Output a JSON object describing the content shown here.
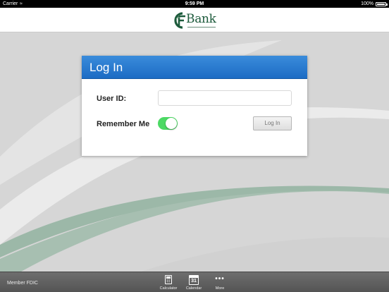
{
  "status_bar": {
    "carrier": "Carrier",
    "time": "9:59 PM",
    "battery_percent": "100%"
  },
  "header": {
    "logo_text": "Bank",
    "logo_mark": "CF",
    "brand_color": "#1d5b3c"
  },
  "login": {
    "title": "Log In",
    "user_id_label": "User ID:",
    "user_id_value": "",
    "remember_label": "Remember Me",
    "remember_me_on": true,
    "login_button_label": "Log In",
    "header_color": "#2a7dd3",
    "toggle_color": "#4cd964"
  },
  "tab_bar": {
    "fdic_text": "Member FDIC",
    "tabs": [
      {
        "label": "Calculator",
        "icon": "calculator-icon"
      },
      {
        "label": "Calendar",
        "icon": "calendar-icon",
        "icon_text": "31"
      },
      {
        "label": "More",
        "icon": "more-icon"
      }
    ]
  }
}
